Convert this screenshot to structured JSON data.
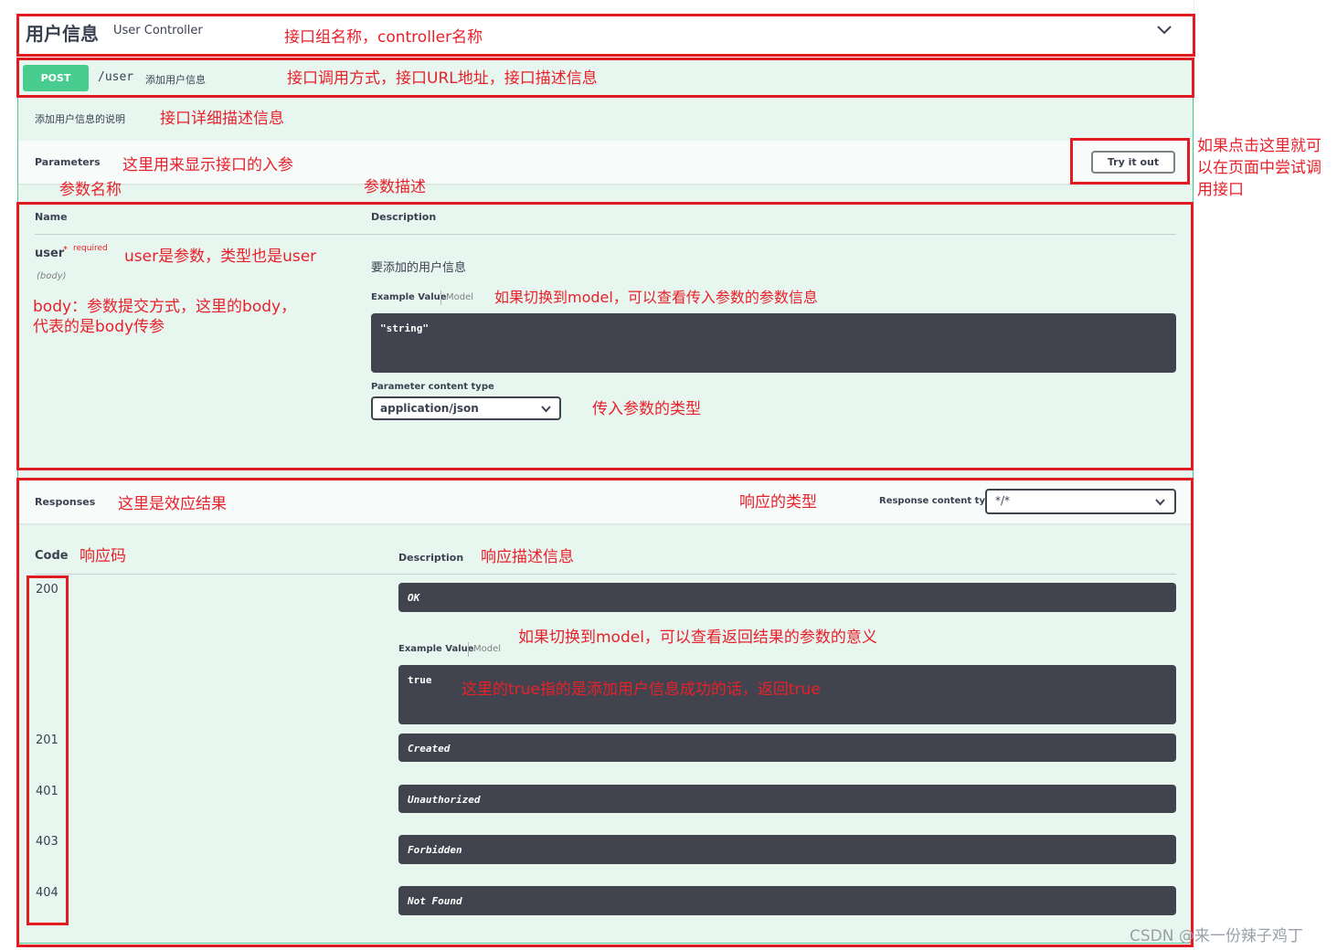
{
  "header": {
    "title": "用户信息",
    "subtitle": "User Controller",
    "annotation": "接口组名称，controller名称"
  },
  "operation": {
    "method": "POST",
    "path": "/user",
    "summary": "添加用户信息",
    "annotation": "接口调用方式，接口URL地址，接口描述信息",
    "description": "添加用户信息的说明",
    "description_annotation": "接口详细描述信息"
  },
  "parameters": {
    "heading": "Parameters",
    "annotation": "这里用来显示接口的入参",
    "try_button": "Try it out",
    "try_annotation": "如果点击这里就可\n以在页面中尝试调\n用接口",
    "name_col_annotation": "参数名称",
    "desc_col_annotation": "参数描述",
    "col_name": "Name",
    "col_description": "Description",
    "param_name": "user",
    "required_mark": "*",
    "required_label": "required",
    "param_in": "(body)",
    "param_annotation": "user是参数，类型也是user",
    "body_annotation": "body：参数提交方式，这里的body，\n代表的是body传参",
    "param_desc": "要添加的用户信息",
    "example_tab": "Example Value",
    "model_tab": "Model",
    "model_annotation": "如果切换到model，可以查看传入参数的参数信息",
    "example_code": "\"string\"",
    "content_type_label": "Parameter content type",
    "content_type_value": "application/json",
    "content_type_annotation": "传入参数的类型"
  },
  "responses": {
    "heading": "Responses",
    "annotation": "这里是效应结果",
    "type_annotation": "响应的类型",
    "content_type_label": "Response content type",
    "content_type_value": "*/*",
    "col_code": "Code",
    "code_annotation": "响应码",
    "col_description": "Description",
    "desc_annotation": "响应描述信息",
    "example_tab": "Example Value",
    "model_tab": "Model",
    "model_annotation": "如果切换到model，可以查看返回结果的参数的意义",
    "example_code": "true",
    "example_annotation": "这里的true指的是添加用户信息成功的话，返回true",
    "rows": [
      {
        "code": "200",
        "desc": "OK"
      },
      {
        "code": "201",
        "desc": "Created"
      },
      {
        "code": "401",
        "desc": "Unauthorized"
      },
      {
        "code": "403",
        "desc": "Forbidden"
      },
      {
        "code": "404",
        "desc": "Not Found"
      }
    ]
  },
  "watermark": "CSDN @来一份辣子鸡丁"
}
